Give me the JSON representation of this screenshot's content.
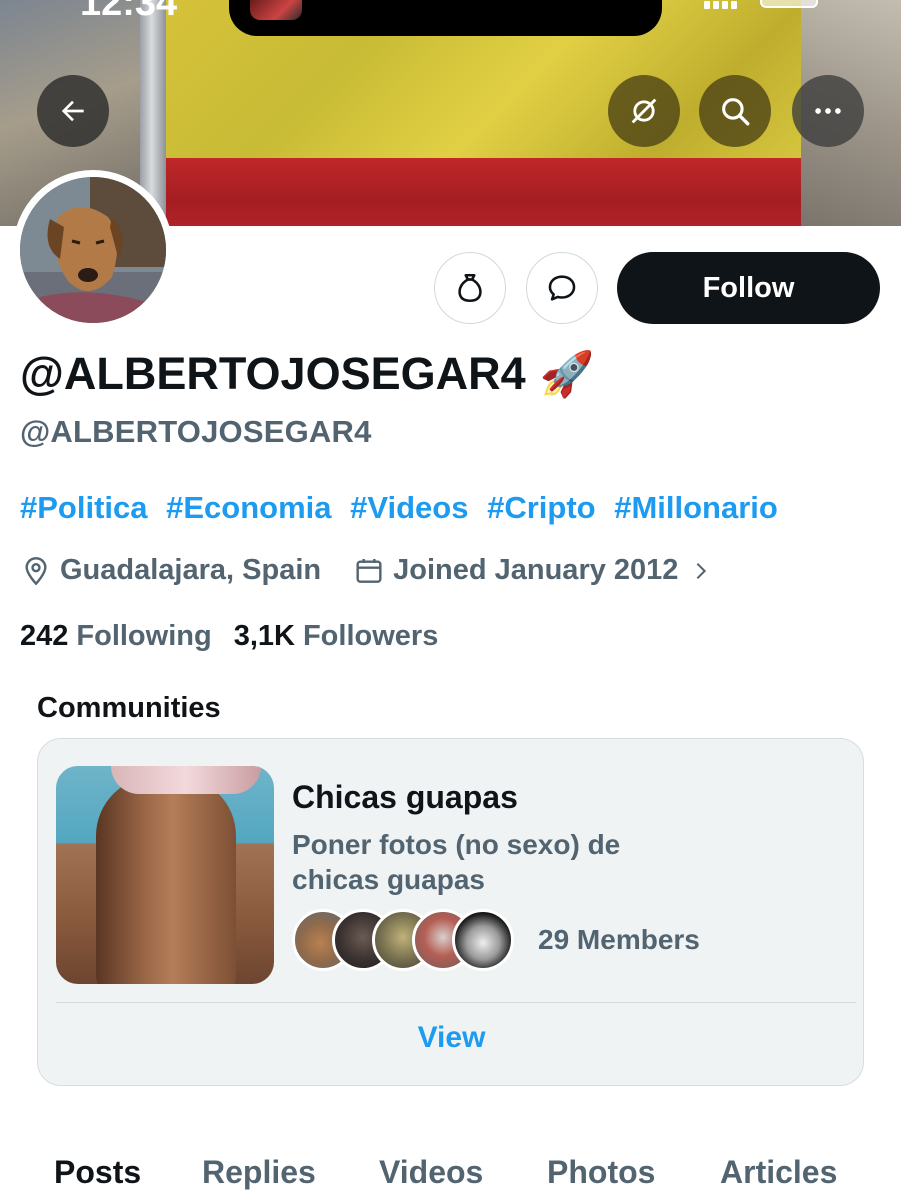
{
  "status_bar": {
    "time": "12:34"
  },
  "header": {
    "back_icon": "arrow-left-icon",
    "hide_icon": "eye-slash-icon",
    "search_icon": "search-icon",
    "more_icon": "more-horizontal-icon"
  },
  "actions": {
    "tip_icon": "money-bag-icon",
    "message_icon": "chat-bubble-icon",
    "follow_label": "Follow"
  },
  "profile": {
    "display_name": "@ALBERTOJOSEGAR4",
    "display_emoji": "🚀",
    "handle": "@ALBERTOJOSEGAR4",
    "bio_tags": [
      "#Politica",
      "#Economia",
      "#Videos",
      "#Cripto",
      "#Millonario"
    ],
    "location": "Guadalajara, Spain",
    "joined": "Joined January 2012",
    "following_count": "242",
    "following_label": "Following",
    "followers_count": "3,1K",
    "followers_label": "Followers"
  },
  "communities": {
    "title": "Communities",
    "card": {
      "name": "Chicas guapas",
      "description": "Poner fotos (no sexo) de chicas guapas",
      "members_label": "29 Members",
      "view_label": "View"
    }
  },
  "tabs": [
    "Posts",
    "Replies",
    "Videos",
    "Photos",
    "Articles"
  ],
  "colors": {
    "accent": "#1d9bf0",
    "text_primary": "#0f1419",
    "text_secondary": "#536471",
    "follow_bg": "#0f1419"
  }
}
